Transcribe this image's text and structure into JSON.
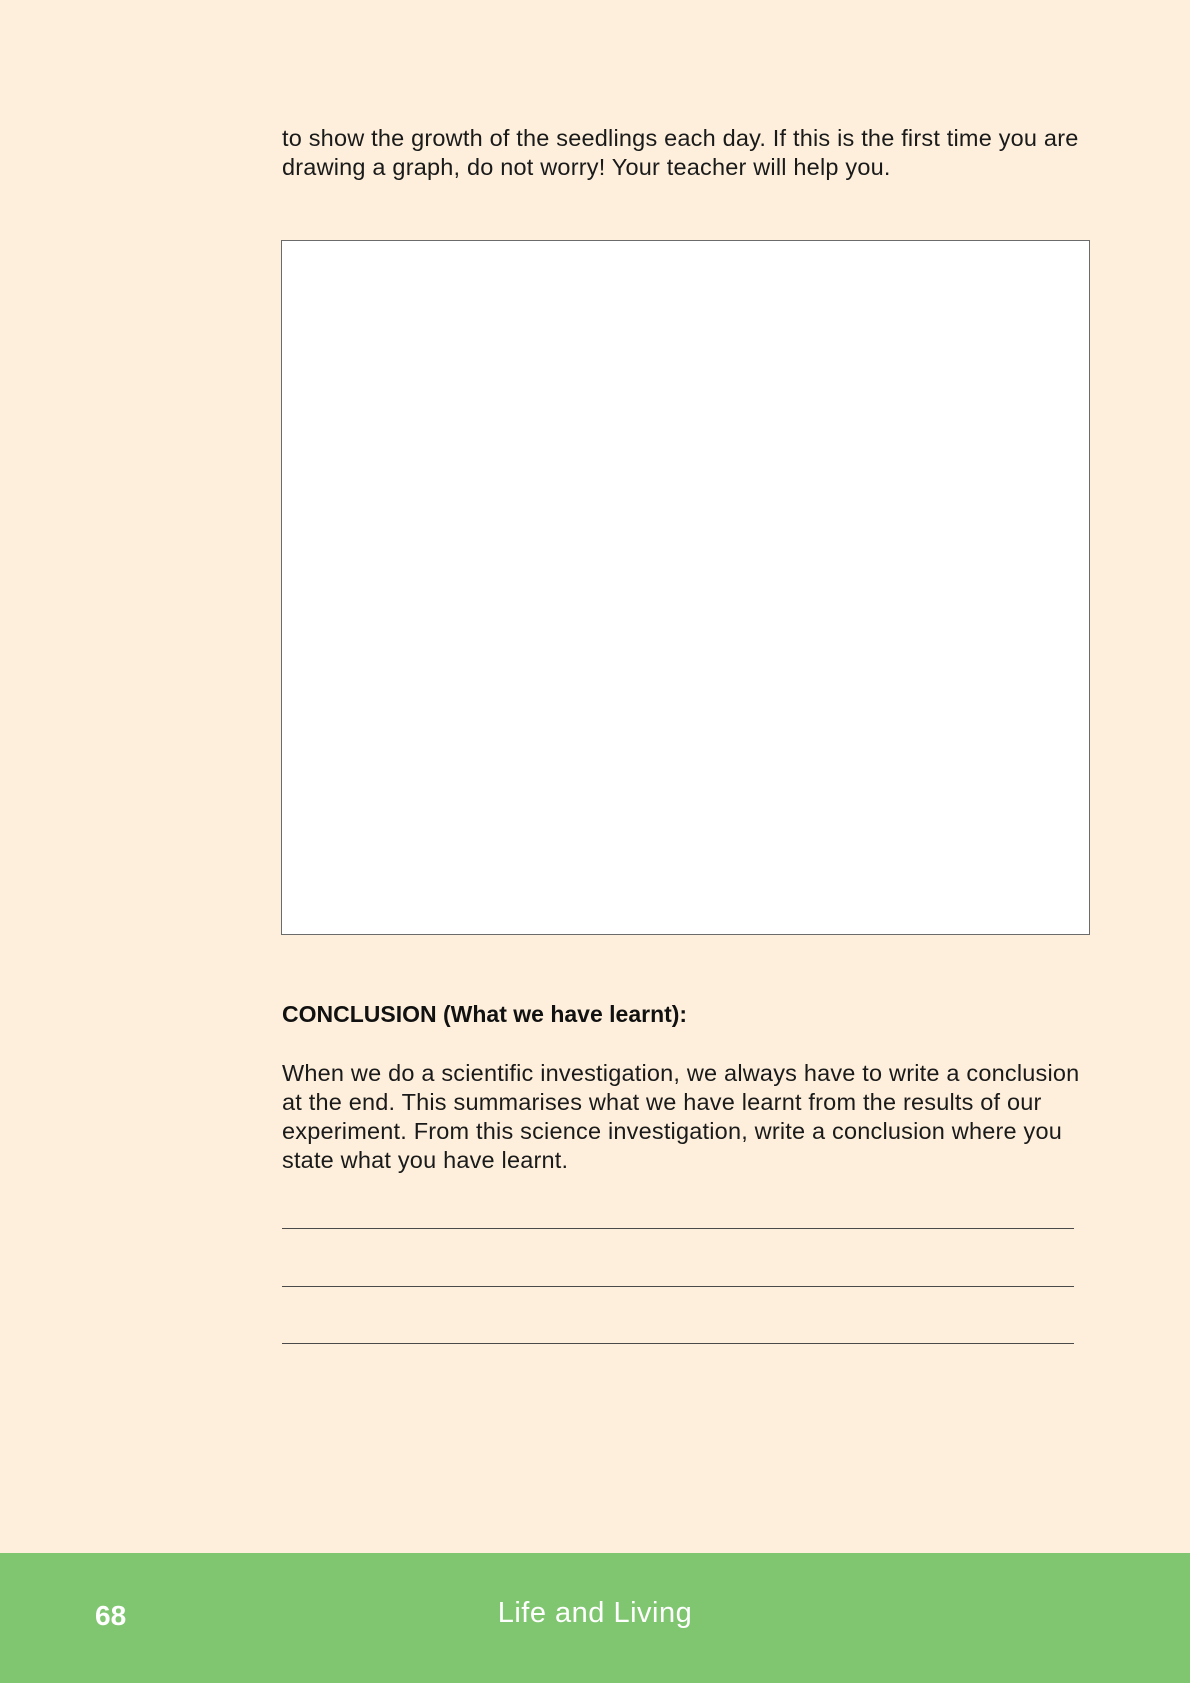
{
  "intro": {
    "text": "to show the growth of the seedlings each day. If this is the first time you are drawing a graph, do not worry! Your teacher will help you."
  },
  "conclusion": {
    "heading": "CONCLUSION (What we have learnt):",
    "body": "When we do a scientific investigation, we always have to write a conclusion at the end. This summarises what we have learnt from the results of our experiment. From this science investigation, write a conclusion where you state what you have learnt."
  },
  "footer": {
    "page_number": "68",
    "title": "Life and Living"
  },
  "colors": {
    "page_background": "#fdefdb",
    "footer_background": "#80c671"
  }
}
